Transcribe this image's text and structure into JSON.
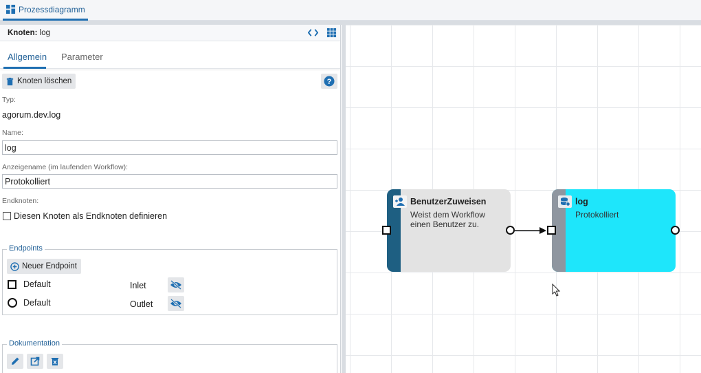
{
  "tab": {
    "label": "Prozessdiagramm"
  },
  "panel": {
    "header_prefix": "Knoten:",
    "header_name": "log",
    "tabs": [
      "Allgemein",
      "Parameter"
    ],
    "delete_button": "Knoten löschen",
    "type_label": "Typ:",
    "type_value": "agorum.dev.log",
    "name_label": "Name:",
    "name_value": "log",
    "display_label": "Anzeigename (im laufenden Workflow):",
    "display_value": "Protokolliert",
    "end_label": "Endknoten:",
    "end_checkbox": "Diesen Knoten als Endknoten definieren",
    "endpoints": {
      "legend": "Endpoints",
      "new_button": "Neuer Endpoint",
      "rows": [
        {
          "name": "Default",
          "type": "Inlet",
          "shape": "square"
        },
        {
          "name": "Default",
          "type": "Outlet",
          "shape": "circle"
        }
      ]
    },
    "documentation": {
      "legend": "Dokumentation"
    }
  },
  "canvas": {
    "nodes": [
      {
        "title": "BenutzerZuweisen",
        "description": "Weist dem Workflow\neinen Benutzer zu.",
        "stripe_color": "#1e5f82",
        "bg_color": "#e3e3e3"
      },
      {
        "title": "log",
        "description": "Protokolliert",
        "stripe_color": "#8f96a0",
        "bg_color": "#1ee6fb"
      }
    ]
  },
  "colors": {
    "accent": "#1f6fb2",
    "icon_blue": "#1f6fb2"
  }
}
